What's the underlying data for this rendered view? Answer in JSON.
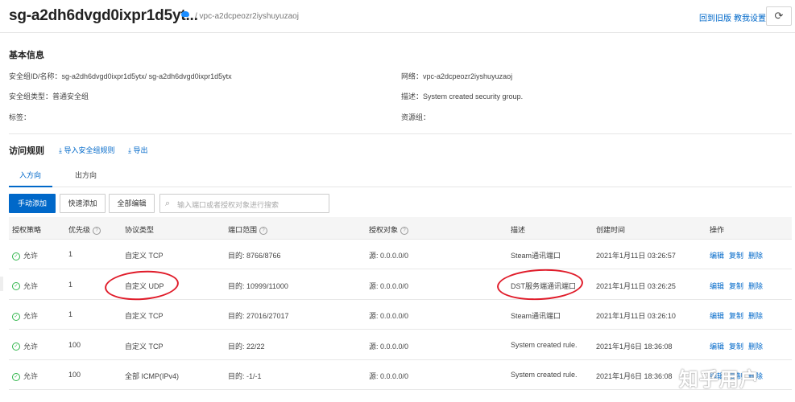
{
  "header": {
    "title": "sg-a2dh6dvgd0ixpr1d5yt...",
    "vpc": "/ vpc-a2dcpeozr2iyshuyuzaoj",
    "back_old": "回到旧版",
    "tutorial": "教我设置",
    "refresh_icon": "refresh-icon",
    "refresh_glyph": "⟳"
  },
  "basic": {
    "title": "基本信息",
    "id_label": "安全组ID/名称：",
    "id_value": "sg-a2dh6dvgd0ixpr1d5ytx/ sg-a2dh6dvgd0ixpr1d5ytx",
    "type_label": "安全组类型：",
    "type_value": "普通安全组",
    "tags_label": "标签：",
    "network_label": "网络：",
    "network_value": "vpc-a2dcpeozr2iyshuyuzaoj",
    "desc_label": "描述：",
    "desc_value": "System created security group.",
    "rg_label": "资源组："
  },
  "rules": {
    "title": "访问规则",
    "import_label": "导入安全组规则",
    "export_label": "导出",
    "tab_in": "入方向",
    "tab_out": "出方向",
    "btn_manual": "手动添加",
    "btn_quick": "快速添加",
    "btn_editall": "全部编辑",
    "search_placeholder": "输入端口或者授权对象进行搜索",
    "columns": [
      "授权策略",
      "优先级",
      "协议类型",
      "端口范围",
      "授权对象",
      "描述",
      "创建时间",
      "操作"
    ],
    "op_edit": "编辑",
    "op_copy": "复制",
    "op_delete": "删除",
    "rows": [
      {
        "policy": "允许",
        "priority": "1",
        "protocol": "自定义 TCP",
        "port": "目的: 8766/8766",
        "target": "源: 0.0.0.0/0",
        "desc": "Steam通讯端口",
        "time": "2021年1月11日 03:26:57"
      },
      {
        "policy": "允许",
        "priority": "1",
        "protocol": "自定义 UDP",
        "port": "目的: 10999/11000",
        "target": "源: 0.0.0.0/0",
        "desc": "DST服务端通讯端口",
        "time": "2021年1月11日 03:26:25"
      },
      {
        "policy": "允许",
        "priority": "1",
        "protocol": "自定义 TCP",
        "port": "目的: 27016/27017",
        "target": "源: 0.0.0.0/0",
        "desc": "Steam通讯端口",
        "time": "2021年1月11日 03:26:10"
      },
      {
        "policy": "允许",
        "priority": "100",
        "protocol": "自定义 TCP",
        "port": "目的: 22/22",
        "target": "源: 0.0.0.0/0",
        "desc": "System created rule.",
        "time": "2021年1月6日 18:36:08"
      },
      {
        "policy": "允许",
        "priority": "100",
        "protocol": "全部 ICMP(IPv4)",
        "port": "目的: -1/-1",
        "target": "源: 0.0.0.0/0",
        "desc": "System created rule.",
        "time": "2021年1月6日 18:36:08"
      }
    ]
  },
  "watermark": "知乎用户",
  "colors": {
    "accent": "#0068c9",
    "success": "#2fb54a",
    "annotation": "#e01c2a"
  }
}
